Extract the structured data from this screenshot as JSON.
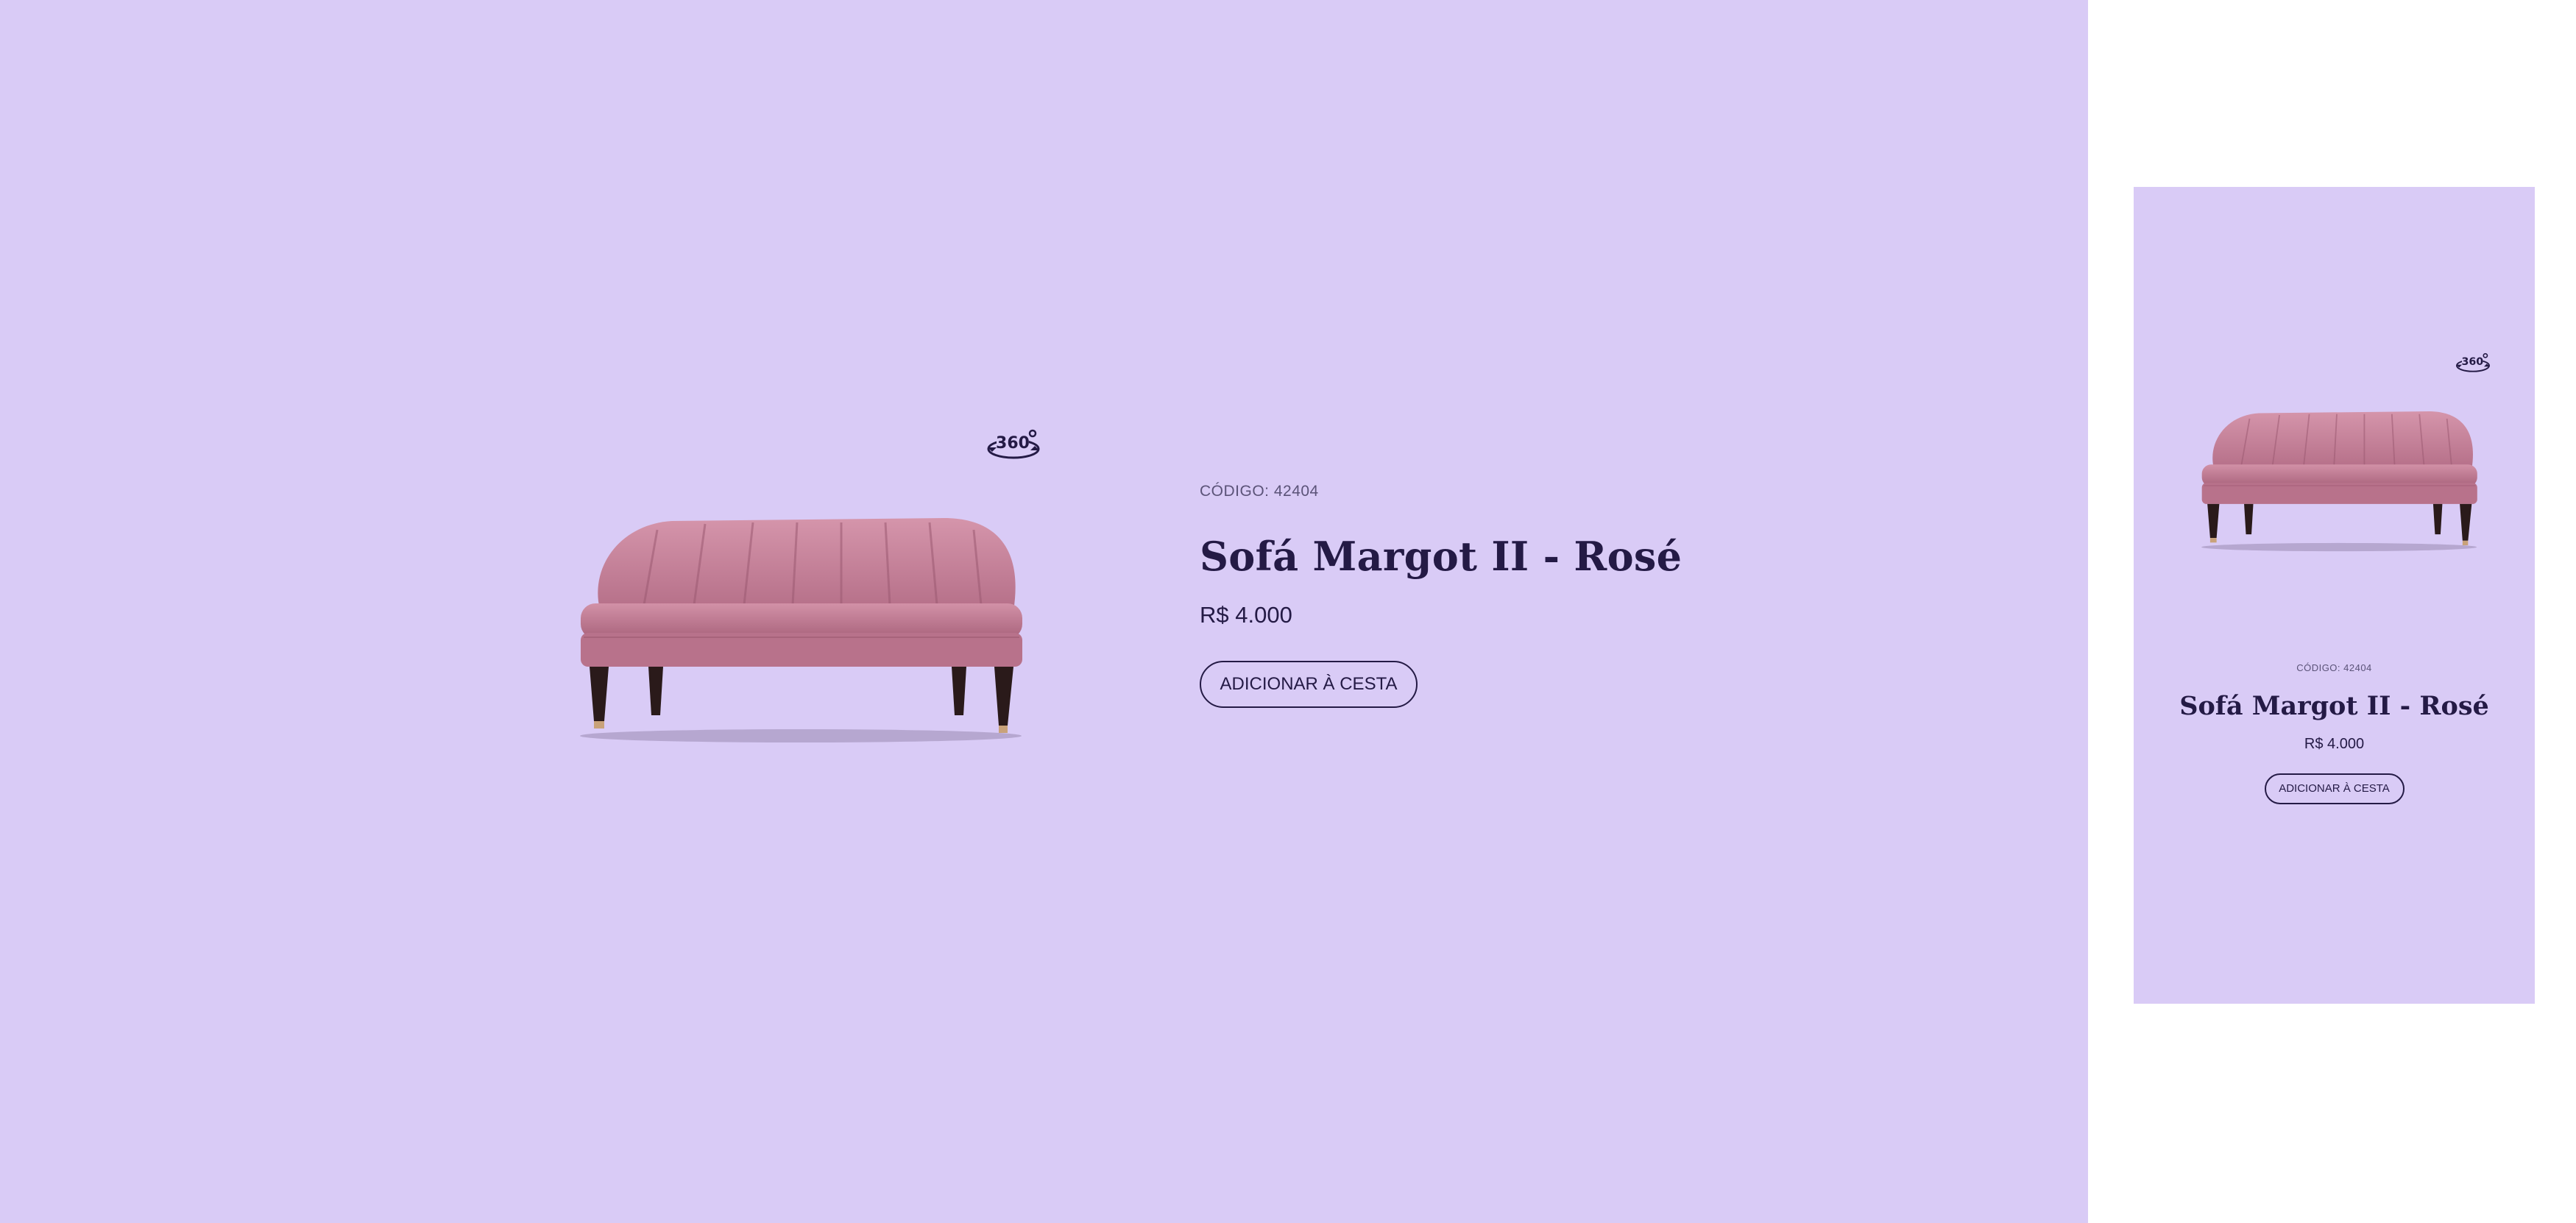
{
  "product": {
    "code_label": "CÓDIGO: 42404",
    "name": "Sofá Margot II - Rosé",
    "price": "R$ 4.000",
    "add_to_cart_label": "ADICIONAR À CESTA"
  },
  "viewer": {
    "icon": "360-view-icon",
    "icon_text": "360"
  },
  "colors": {
    "background": "#d9cbf6",
    "text": "#241a45",
    "sofa": "#c27d96",
    "legs": "#2a1a1a"
  }
}
